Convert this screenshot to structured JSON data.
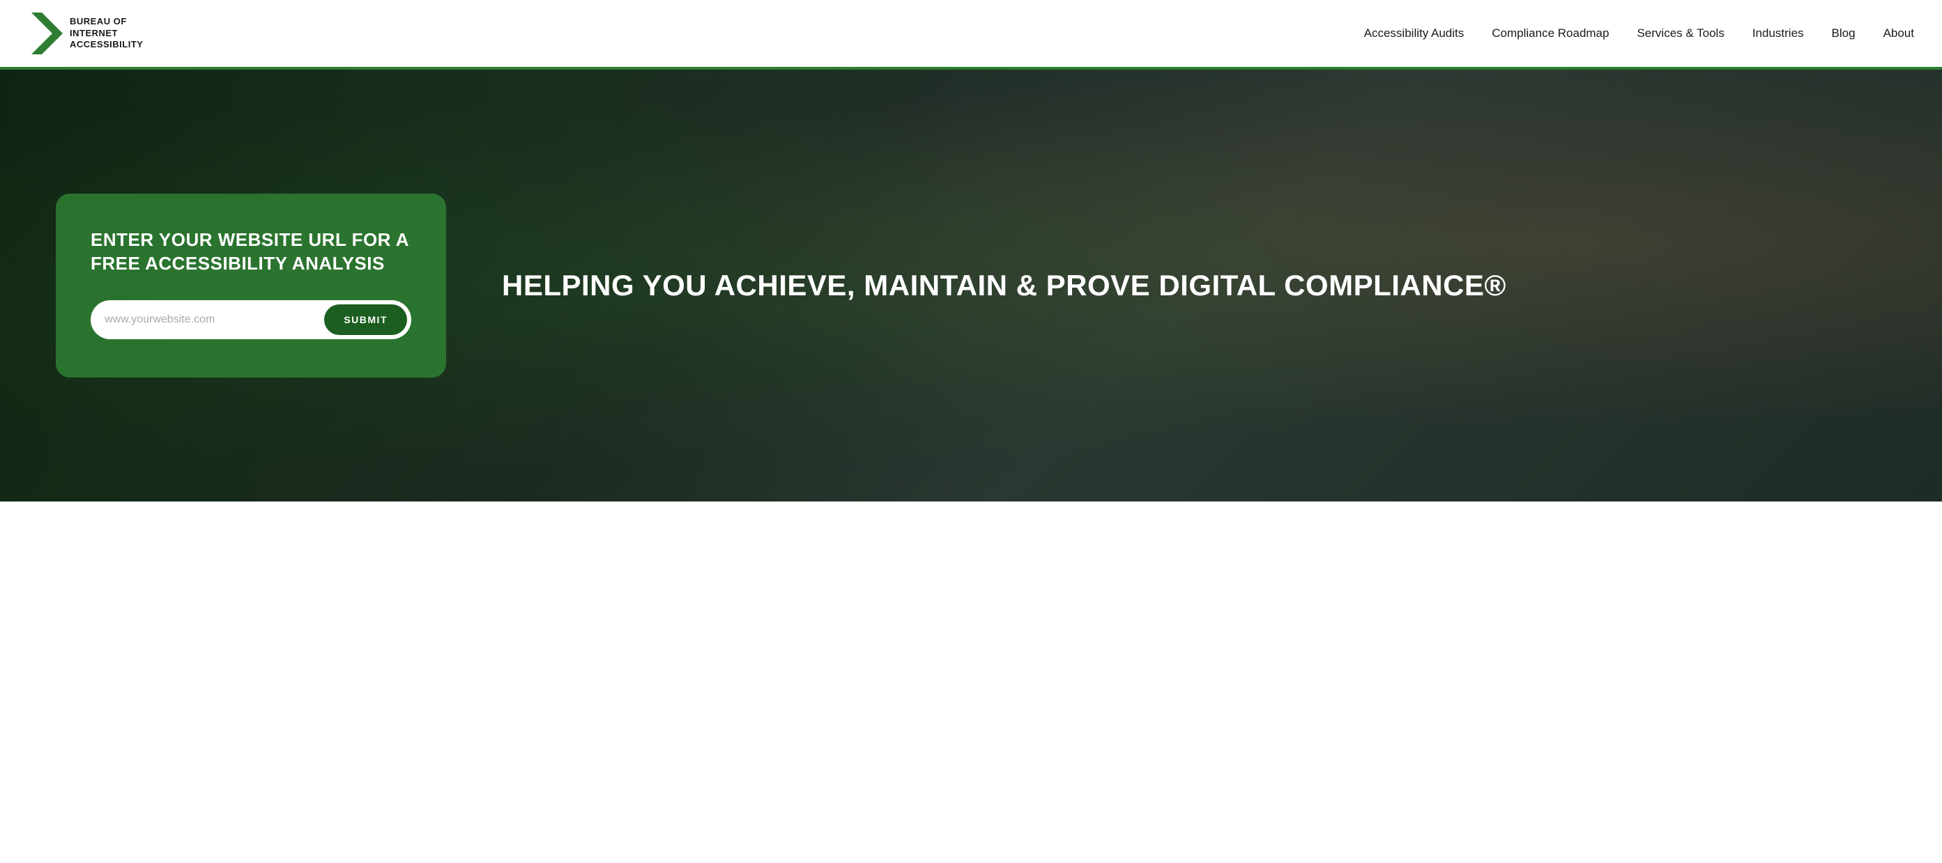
{
  "header": {
    "logo_text": "BUREAU OF\nINTERNET\nACCESSIBILITY",
    "nav_links": [
      {
        "label": "Accessibility Audits",
        "id": "accessibility-audits"
      },
      {
        "label": "Compliance Roadmap",
        "id": "compliance-roadmap"
      },
      {
        "label": "Services & Tools",
        "id": "services-tools"
      },
      {
        "label": "Industries",
        "id": "industries"
      },
      {
        "label": "Blog",
        "id": "blog"
      },
      {
        "label": "About",
        "id": "about"
      }
    ]
  },
  "hero": {
    "card": {
      "title": "ENTER YOUR WEBSITE URL FOR A FREE ACCESSIBILITY ANALYSIS",
      "input_placeholder": "www.yourwebsite.com",
      "submit_label": "SUBMIT"
    },
    "tagline": "HELPING YOU ACHIEVE, MAINTAIN & PROVE DIGITAL COMPLIANCE®"
  },
  "colors": {
    "green_dark": "#1b5e20",
    "green_medium": "#2e7d32",
    "green_accent": "#4caf50",
    "white": "#ffffff",
    "dark": "#1a1a1a"
  }
}
